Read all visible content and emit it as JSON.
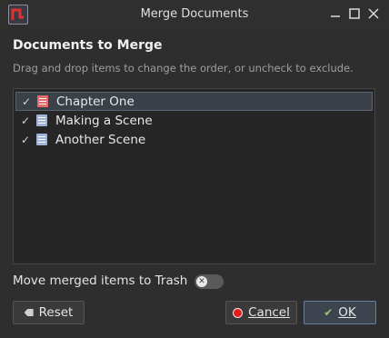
{
  "window": {
    "title": "Merge Documents",
    "controls": [
      "minimize",
      "maximize",
      "close"
    ]
  },
  "header": {
    "heading": "Documents to Merge",
    "subtitle": "Drag and drop items to change the order, or uncheck to exclude."
  },
  "documents": [
    {
      "name": "Chapter One",
      "checked": true,
      "icon": "red-document-icon",
      "selected": true
    },
    {
      "name": "Making a Scene",
      "checked": true,
      "icon": "blue-document-icon",
      "selected": false
    },
    {
      "name": "Another Scene",
      "checked": true,
      "icon": "blue-document-icon",
      "selected": false
    }
  ],
  "options": {
    "trash_label": "Move merged items to Trash",
    "trash_toggle_on": false
  },
  "buttons": {
    "reset": "Reset",
    "cancel": "Cancel",
    "ok": "OK"
  },
  "colors": {
    "background": "#2e2e2e",
    "selection": "#3b4149",
    "cancel_icon": "#e02020",
    "ok_border": "#6c7f98"
  }
}
